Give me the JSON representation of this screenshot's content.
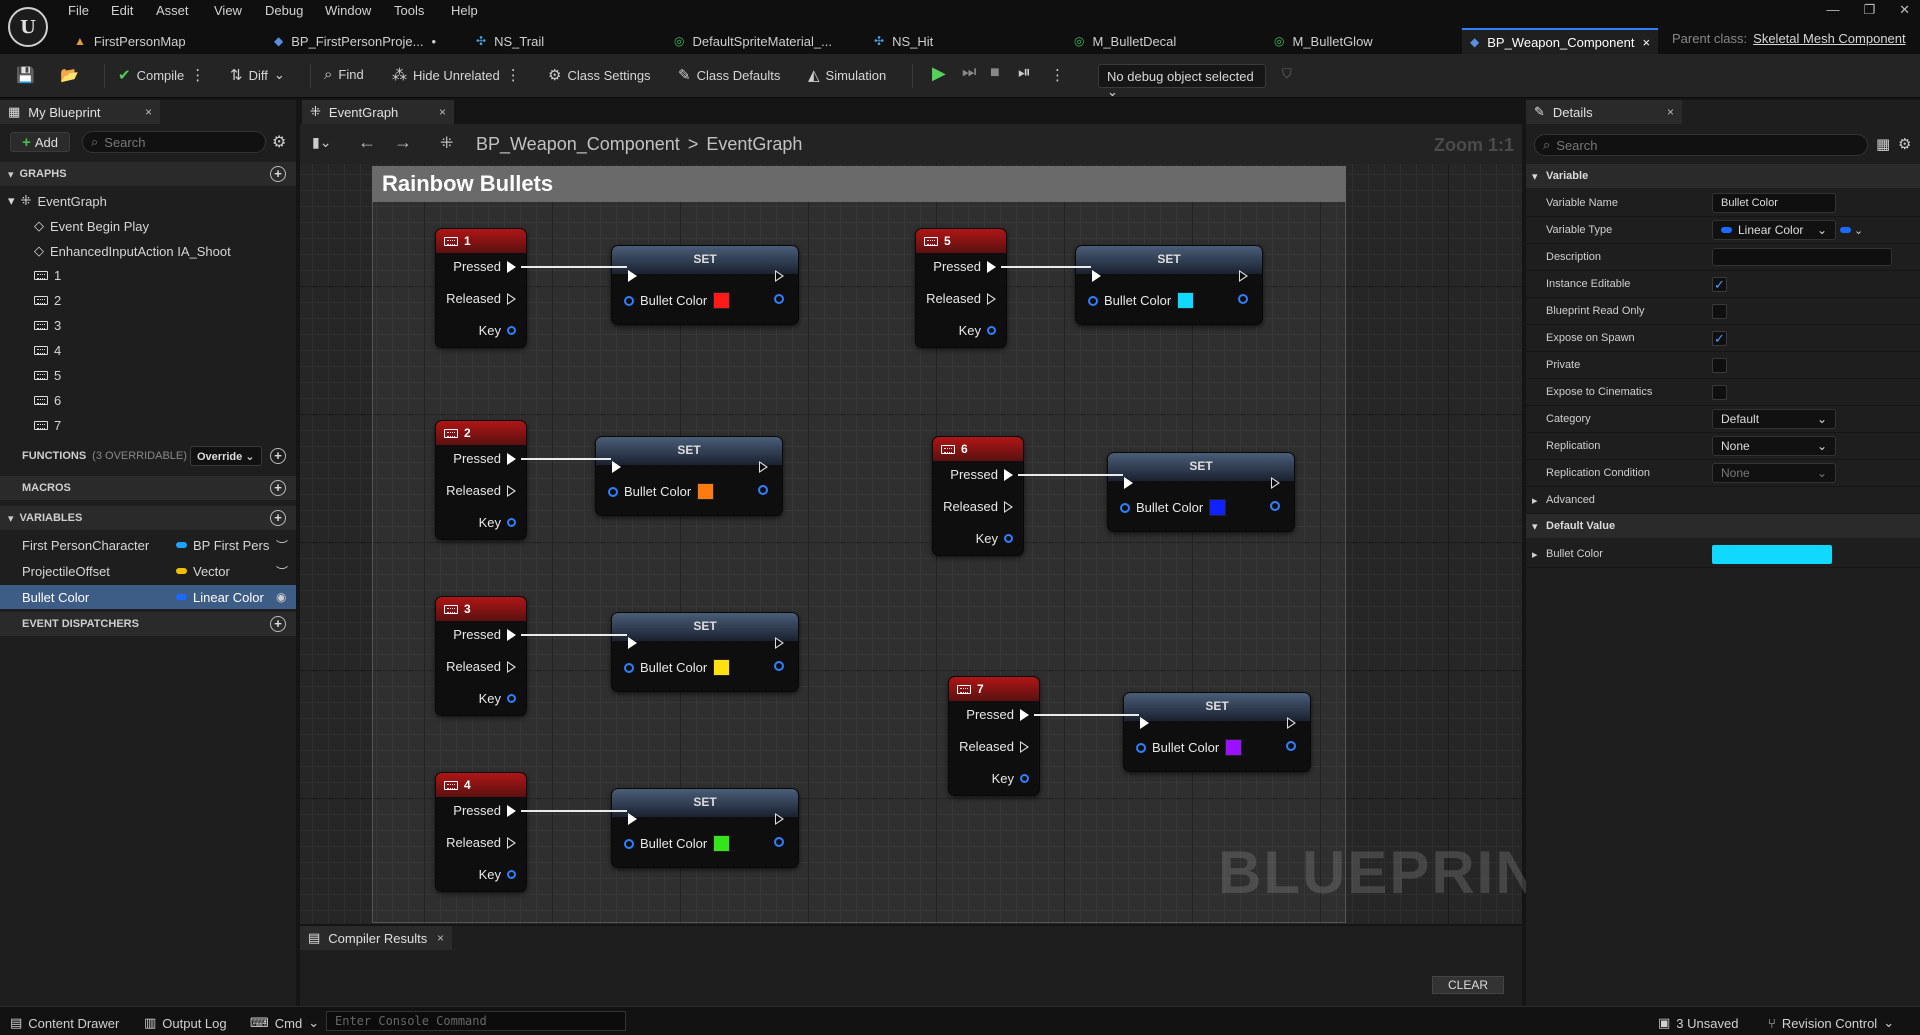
{
  "menu": [
    "File",
    "Edit",
    "Asset",
    "View",
    "Debug",
    "Window",
    "Tools",
    "Help"
  ],
  "doc_tabs": [
    {
      "label": "FirstPersonMap",
      "icon": "level-icon"
    },
    {
      "label": "BP_FirstPersonProje...",
      "icon": "blueprint-icon",
      "dirty": "•"
    },
    {
      "label": "NS_Trail",
      "icon": "niagara-icon"
    },
    {
      "label": "DefaultSpriteMaterial_...",
      "icon": "material-icon"
    },
    {
      "label": "NS_Hit",
      "icon": "niagara-icon"
    },
    {
      "label": "M_BulletDecal",
      "icon": "material-icon"
    },
    {
      "label": "M_BulletGlow",
      "icon": "material-icon"
    },
    {
      "label": "BP_Weapon_Component",
      "icon": "blueprint-icon",
      "close": "×"
    }
  ],
  "parent_class": {
    "label": "Parent class:",
    "value": "Skeletal Mesh Component"
  },
  "toolbar": {
    "compile": "Compile",
    "diff": "Diff",
    "find": "Find",
    "hide_unrelated": "Hide Unrelated",
    "class_settings": "Class Settings",
    "class_defaults": "Class Defaults",
    "simulation": "Simulation",
    "debug_object": "No debug object selected"
  },
  "my_blueprint": {
    "tab": "My Blueprint",
    "add": "Add",
    "search_placeholder": "Search",
    "graphs_header": "GRAPHS",
    "event_graph": "EventGraph",
    "graph_items": [
      "Event Begin Play",
      "EnhancedInputAction IA_Shoot",
      "1",
      "2",
      "3",
      "4",
      "5",
      "6",
      "7"
    ],
    "functions_header": "FUNCTIONS",
    "functions_sub": "(3 OVERRIDABLE)",
    "override": "Override",
    "macros_header": "MACROS",
    "variables_header": "VARIABLES",
    "variables": [
      {
        "name": "First PersonCharacter",
        "type": "BP First Pers",
        "color": "#1aa3ff"
      },
      {
        "name": "ProjectileOffset",
        "type": "Vector",
        "color": "#f0c000"
      },
      {
        "name": "Bullet Color",
        "type": "Linear Color",
        "color": "#1a6bff"
      }
    ],
    "event_dispatchers_header": "EVENT DISPATCHERS"
  },
  "graph": {
    "tab": "EventGraph",
    "breadcrumb_root": "BP_Weapon_Component",
    "breadcrumb_sep": ">",
    "breadcrumb_leaf": "EventGraph",
    "zoom": "Zoom 1:1",
    "comment": "Rainbow Bullets",
    "watermark": "BLUEPRINT",
    "pins": {
      "pressed": "Pressed",
      "released": "Released",
      "key": "Key"
    },
    "set_title": "SET",
    "var_name": "Bullet Color",
    "nodes": [
      {
        "key": "1",
        "color": "#ff1a1a"
      },
      {
        "key": "2",
        "color": "#ff7a10"
      },
      {
        "key": "3",
        "color": "#ffe010"
      },
      {
        "key": "4",
        "color": "#33e61a"
      },
      {
        "key": "5",
        "color": "#10d8ff"
      },
      {
        "key": "6",
        "color": "#1020ff"
      },
      {
        "key": "7",
        "color": "#9a10ff"
      }
    ]
  },
  "compiler": {
    "tab": "Compiler Results",
    "clear": "CLEAR"
  },
  "details": {
    "tab": "Details",
    "search_placeholder": "Search",
    "variable_section": "Variable",
    "variable_name_label": "Variable Name",
    "variable_name_value": "Bullet Color",
    "variable_type_label": "Variable Type",
    "variable_type_value": "Linear Color",
    "description_label": "Description",
    "instance_editable": "Instance Editable",
    "blueprint_read_only": "Blueprint Read Only",
    "expose_on_spawn": "Expose on Spawn",
    "private": "Private",
    "expose_cinematics": "Expose to Cinematics",
    "category_label": "Category",
    "category_value": "Default",
    "replication_label": "Replication",
    "replication_value": "None",
    "replication_condition_label": "Replication Condition",
    "replication_condition_value": "None",
    "advanced": "Advanced",
    "default_value_section": "Default Value",
    "bullet_color_label": "Bullet Color",
    "bullet_color_value": "#10d8ff"
  },
  "statusbar": {
    "content_drawer": "Content Drawer",
    "output_log": "Output Log",
    "cmd": "Cmd",
    "console_placeholder": "Enter Console Command",
    "unsaved": "3 Unsaved",
    "revision_control": "Revision Control"
  }
}
